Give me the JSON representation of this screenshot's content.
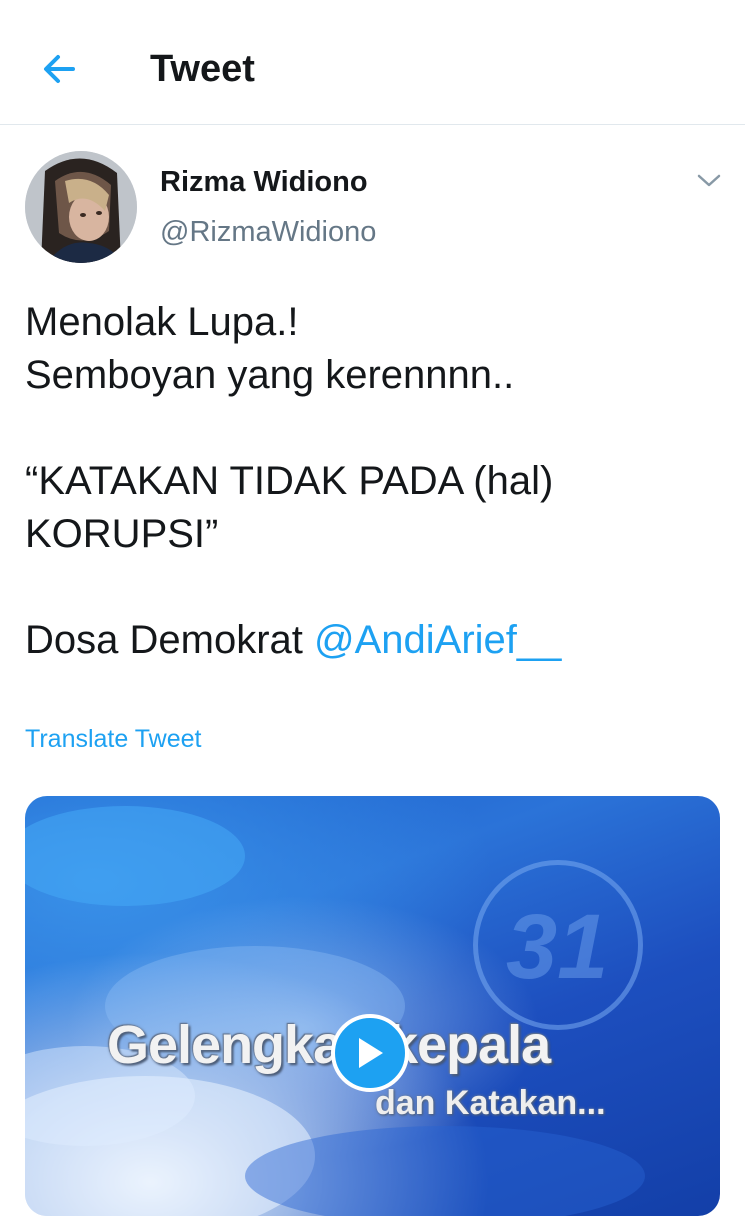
{
  "header": {
    "title": "Tweet"
  },
  "tweet": {
    "author_name": "Rizma Widiono",
    "author_handle": "@RizmaWidiono",
    "lines": [
      "Menolak Lupa.!",
      "Semboyan yang kerennnn..",
      "“KATAKAN TIDAK PADA (hal)",
      "KORUPSI”",
      "Dosa Demokrat "
    ],
    "mention": "@AndiArief__",
    "translate_label": "Translate Tweet"
  },
  "media": {
    "caption_main": "Gelengkan kepala",
    "caption_sub": "dan Katakan...",
    "logo_text": "31"
  },
  "colors": {
    "accent": "#1da1f2",
    "secondary_text": "#657786",
    "border": "#e1e8ed"
  },
  "icons": {
    "back": "arrow-left-icon",
    "caret": "chevron-down-icon",
    "play": "play-icon"
  }
}
